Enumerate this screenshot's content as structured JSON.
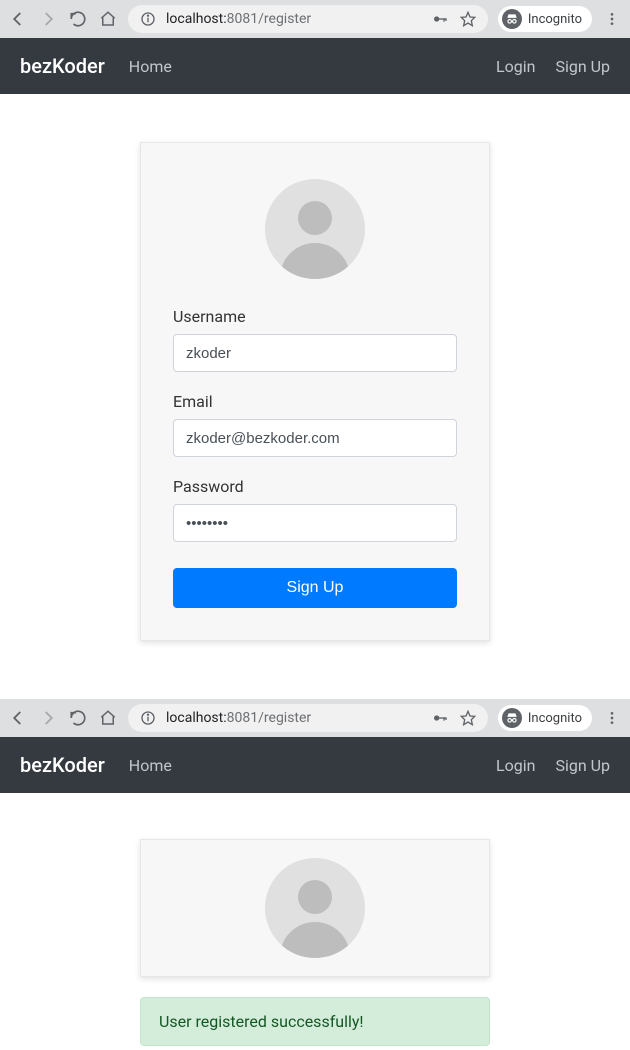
{
  "browser": {
    "url_host": "localhost:",
    "url_port": "8081",
    "url_path": "/register",
    "incognito_label": "Incognito"
  },
  "navbar": {
    "brand": "bezKoder",
    "home": "Home",
    "login": "Login",
    "signup": "Sign Up"
  },
  "form": {
    "username_label": "Username",
    "username_value": "zkoder",
    "email_label": "Email",
    "email_value": "zkoder@bezkoder.com",
    "password_label": "Password",
    "password_value": "••••••••",
    "submit_label": "Sign Up"
  },
  "alert": {
    "success_message": "User registered successfully!"
  },
  "colors": {
    "primary": "#007bff",
    "navbar_bg": "#343a40",
    "success_bg": "#d4edda",
    "success_text": "#155724"
  }
}
